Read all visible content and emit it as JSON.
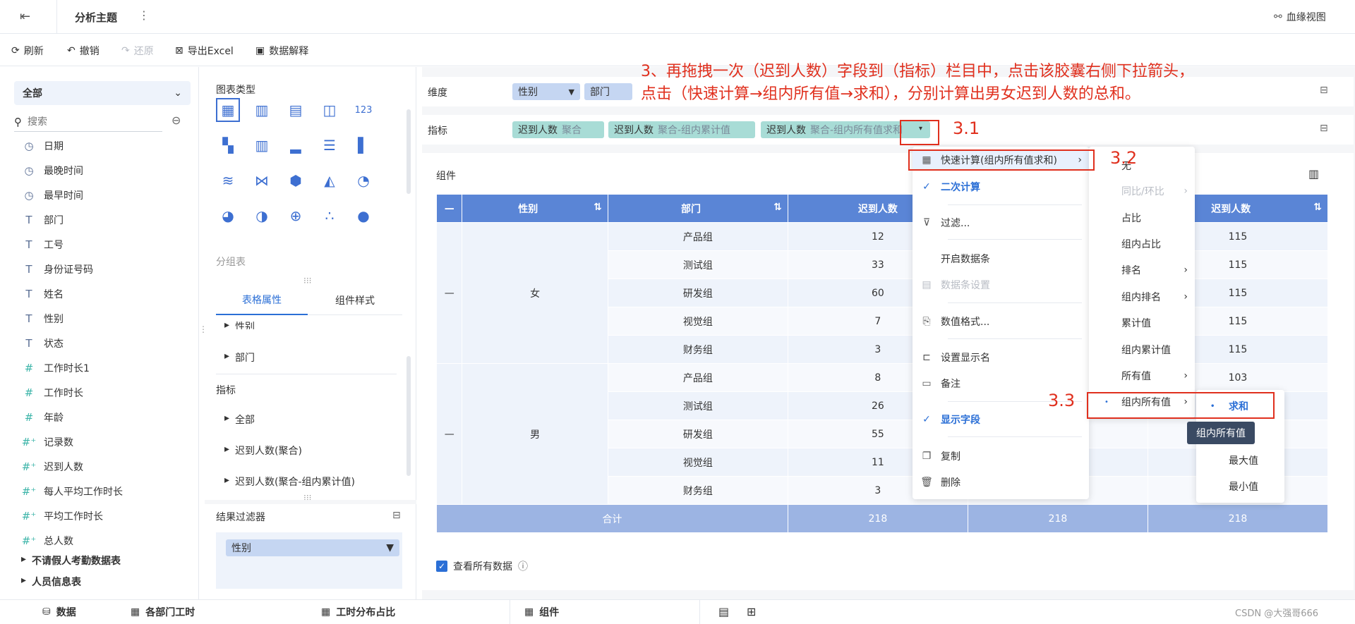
{
  "topbar": {
    "title": "分析主题",
    "more": "⋮",
    "lineage": "血缘视图"
  },
  "toolbar": {
    "refresh": "刷新",
    "undo": "撤销",
    "redo": "还原",
    "export": "导出Excel",
    "explain": "数据解释"
  },
  "left": {
    "scope": "全部",
    "search_placeholder": "搜索",
    "fields": [
      {
        "icon": "clock-icon",
        "label": "日期"
      },
      {
        "icon": "clock-icon",
        "label": "最晚时间"
      },
      {
        "icon": "clock-icon",
        "label": "最早时间"
      },
      {
        "icon": "text-icon",
        "label": "部门"
      },
      {
        "icon": "text-icon",
        "label": "工号"
      },
      {
        "icon": "text-icon",
        "label": "身份证号码"
      },
      {
        "icon": "text-icon",
        "label": "姓名"
      },
      {
        "icon": "text-icon",
        "label": "性别"
      },
      {
        "icon": "text-icon",
        "label": "状态"
      },
      {
        "icon": "hash-icon",
        "label": "工作时长1"
      },
      {
        "icon": "hash-icon",
        "label": "工作时长"
      },
      {
        "icon": "hash-icon",
        "label": "年龄"
      },
      {
        "icon": "hash-calc-icon",
        "label": "记录数"
      },
      {
        "icon": "hash-calc-icon",
        "label": "迟到人数"
      },
      {
        "icon": "hash-calc-icon",
        "label": "每人平均工作时长"
      },
      {
        "icon": "hash-calc-icon",
        "label": "平均工作时长"
      },
      {
        "icon": "hash-calc-icon",
        "label": "总人数"
      }
    ],
    "groups": [
      "不请假人考勤数据表",
      "人员信息表"
    ]
  },
  "mid": {
    "chart_type_label": "图表类型",
    "group_table_label": "分组表",
    "tabs": [
      "表格属性",
      "组件样式"
    ],
    "dims": [
      "性别",
      "部门"
    ],
    "indicator_label": "指标",
    "indicators": [
      "全部",
      "迟到人数(聚合)",
      "迟到人数(聚合-组内累计值)"
    ],
    "filter_label": "结果过滤器",
    "filter_pill": "性别"
  },
  "main": {
    "dim_label": "维度",
    "ind_label": "指标",
    "dim_pills": [
      "性别",
      "部门"
    ],
    "ind_pills": [
      {
        "name": "迟到人数",
        "agg": "聚合"
      },
      {
        "name": "迟到人数",
        "agg": "聚合-组内累计值"
      },
      {
        "name": "迟到人数",
        "agg": "聚合-组内所有值求和"
      }
    ],
    "component_label": "组件",
    "headers": [
      "—",
      "性别",
      "部门",
      "迟到人数",
      "迟到人数"
    ],
    "rows": [
      {
        "dept": "产品组",
        "v1": "12",
        "v3": "115"
      },
      {
        "dept": "测试组",
        "v1": "33",
        "v3": "115"
      },
      {
        "dept": "研发组",
        "v1": "60",
        "v3": "115"
      },
      {
        "dept": "视觉组",
        "v1": "7",
        "v3": "115"
      },
      {
        "dept": "财务组",
        "v1": "3",
        "v3": "115"
      },
      {
        "dept": "产品组",
        "v1": "8",
        "v3": "103"
      },
      {
        "dept": "测试组",
        "v1": "26",
        "v3": ""
      },
      {
        "dept": "研发组",
        "v1": "55",
        "v3": ""
      },
      {
        "dept": "视觉组",
        "v1": "11",
        "v3": ""
      },
      {
        "dept": "财务组",
        "v1": "3",
        "v3": ""
      }
    ],
    "gender_f": "女",
    "gender_m": "男",
    "total_label": "合计",
    "totals": [
      "218",
      "218",
      "218"
    ],
    "show_all": "查看所有数据",
    "partial_cell": "103"
  },
  "menu": {
    "quick_calc": "快速计算(组内所有值求和)",
    "items": [
      "二次计算",
      "过滤...",
      "开启数据条",
      "数据条设置",
      "数值格式...",
      "设置显示名",
      "备注",
      "显示字段",
      "复制",
      "删除"
    ],
    "sub": [
      "无",
      "同比/环比",
      "占比",
      "组内占比",
      "排名",
      "组内排名",
      "累计值",
      "组内累计值",
      "所有值",
      "组内所有值"
    ],
    "sub2": [
      "求和",
      "组内所有值",
      "最大值",
      "最小值"
    ]
  },
  "annot": {
    "title_line1": "3、再拖拽一次（迟到人数）字段到（指标）栏目中，点击该胶囊右侧下拉箭头，",
    "title_line2": "点击（快速计算→组内所有值→求和），分别计算出男女迟到人数的总和。",
    "s31": "3.1",
    "s32": "3.2",
    "s33": "3.3"
  },
  "bottom": {
    "tabs": [
      "数据",
      "各部门工时",
      "工时分布占比",
      "组件"
    ],
    "watermark": "CSDN @大强哥666"
  }
}
